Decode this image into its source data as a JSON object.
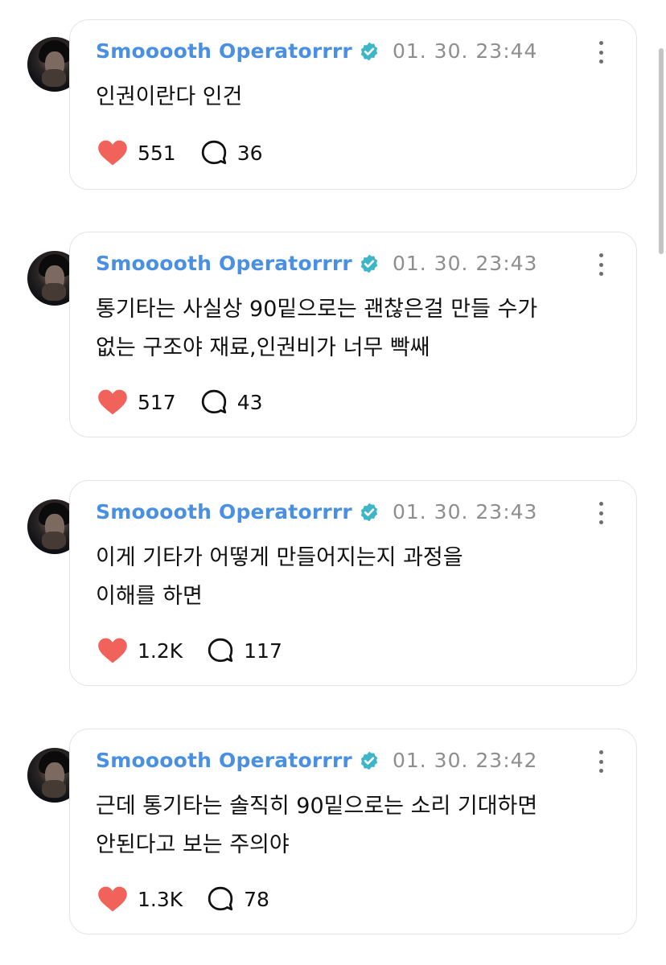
{
  "colors": {
    "username": "#4a90e2",
    "verified_badge": "#3fb6c8",
    "heart": "#f0625a",
    "timestamp": "#8e8e8e"
  },
  "posts": [
    {
      "author": "Smooooth Operatorrrr",
      "verified": true,
      "timestamp": "01. 30. 23:44",
      "text": "인권이란다 인건",
      "likes": "551",
      "replies": "36"
    },
    {
      "author": "Smooooth Operatorrrr",
      "verified": true,
      "timestamp": "01. 30. 23:43",
      "text": "통기타는 사실상 90밑으로는 괜찮은걸 만들 수가\n없는 구조야 재료,인권비가 너무 빡쌔",
      "likes": "517",
      "replies": "43"
    },
    {
      "author": "Smooooth Operatorrrr",
      "verified": true,
      "timestamp": "01. 30. 23:43",
      "text": "이게 기타가 어떻게 만들어지는지 과정을\n이해를 하면",
      "likes": "1.2K",
      "replies": "117"
    },
    {
      "author": "Smooooth Operatorrrr",
      "verified": true,
      "timestamp": "01. 30. 23:42",
      "text": "근데 통기타는 솔직히 90밑으로는 소리 기대하면\n안된다고 보는 주의야",
      "likes": "1.3K",
      "replies": "78"
    }
  ]
}
